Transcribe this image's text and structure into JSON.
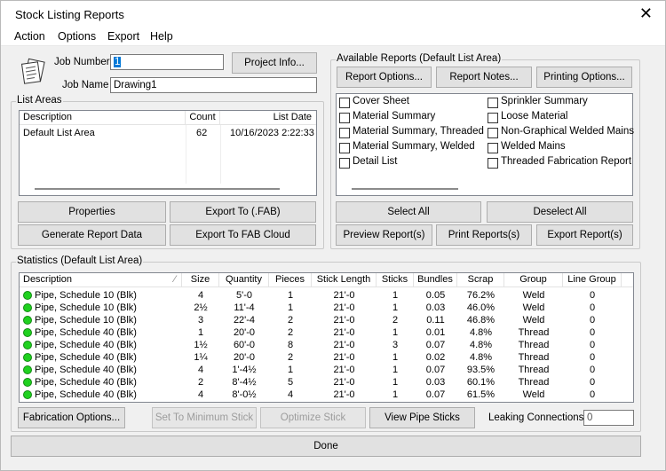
{
  "window": {
    "title": "Stock Listing Reports"
  },
  "menu": [
    "Action",
    "Options",
    "Export",
    "Help"
  ],
  "job": {
    "number_label": "Job Number",
    "number_value": "1",
    "name_label": "Job Name",
    "name_value": "Drawing1",
    "project_info_button": "Project Info..."
  },
  "list_areas": {
    "label": "List Areas",
    "columns": [
      "Description",
      "Count",
      "List Date"
    ],
    "rows": [
      {
        "description": "Default List Area",
        "count": "62",
        "date": "10/16/2023 2:22:33"
      }
    ],
    "buttons": {
      "properties": "Properties",
      "export_fab": "Export To (.FAB)",
      "generate": "Generate Report Data",
      "export_cloud": "Export To FAB Cloud"
    }
  },
  "reports": {
    "label": "Available Reports (Default List Area)",
    "buttons": {
      "report_options": "Report Options...",
      "report_notes": "Report Notes...",
      "printing_options": "Printing Options...",
      "select_all": "Select All",
      "deselect_all": "Deselect All",
      "preview": "Preview Report(s)",
      "print": "Print Reports(s)",
      "export": "Export Report(s)"
    },
    "left_items": [
      "Cover Sheet",
      "Material Summary",
      "Material Summary, Threaded",
      "Material Summary, Welded",
      "Detail List"
    ],
    "right_items": [
      "Sprinkler Summary",
      "Loose Material",
      "Non-Graphical Welded Mains",
      "Welded Mains",
      "Threaded Fabrication Report"
    ]
  },
  "statistics": {
    "label": "Statistics (Default List Area)",
    "columns": [
      "Description",
      "Size",
      "Quantity",
      "Pieces",
      "Stick Length",
      "Sticks",
      "Bundles",
      "Scrap",
      "Group",
      "Line Group"
    ],
    "rows": [
      [
        "Pipe, Schedule 10 (Blk)",
        "4",
        "5'-0",
        "1",
        "21'-0",
        "1",
        "0.05",
        "76.2%",
        "Weld",
        "0"
      ],
      [
        "Pipe, Schedule 10 (Blk)",
        "2½",
        "11'-4",
        "1",
        "21'-0",
        "1",
        "0.03",
        "46.0%",
        "Weld",
        "0"
      ],
      [
        "Pipe, Schedule 10 (Blk)",
        "3",
        "22'-4",
        "2",
        "21'-0",
        "2",
        "0.11",
        "46.8%",
        "Weld",
        "0"
      ],
      [
        "Pipe, Schedule 40 (Blk)",
        "1",
        "20'-0",
        "2",
        "21'-0",
        "1",
        "0.01",
        "4.8%",
        "Thread",
        "0"
      ],
      [
        "Pipe, Schedule 40 (Blk)",
        "1½",
        "60'-0",
        "8",
        "21'-0",
        "3",
        "0.07",
        "4.8%",
        "Thread",
        "0"
      ],
      [
        "Pipe, Schedule 40 (Blk)",
        "1¼",
        "20'-0",
        "2",
        "21'-0",
        "1",
        "0.02",
        "4.8%",
        "Thread",
        "0"
      ],
      [
        "Pipe, Schedule 40 (Blk)",
        "4",
        "1'-4½",
        "1",
        "21'-0",
        "1",
        "0.07",
        "93.5%",
        "Thread",
        "0"
      ],
      [
        "Pipe, Schedule 40 (Blk)",
        "2",
        "8'-4½",
        "5",
        "21'-0",
        "1",
        "0.03",
        "60.1%",
        "Thread",
        "0"
      ],
      [
        "Pipe, Schedule 40 (Blk)",
        "4",
        "8'-0½",
        "4",
        "21'-0",
        "1",
        "0.07",
        "61.5%",
        "Weld",
        "0"
      ]
    ],
    "buttons": {
      "fabrication_options": "Fabrication Options...",
      "set_min_stick": "Set To Minimum Stick",
      "optimize_stick": "Optimize Stick",
      "view_pipe_sticks": "View Pipe Sticks"
    },
    "leaking_label": "Leaking Connections",
    "leaking_value": "0"
  },
  "done_button": "Done",
  "colors": {
    "status_dot": "#1fd11f",
    "selected_text_bg": "#0078d7"
  }
}
